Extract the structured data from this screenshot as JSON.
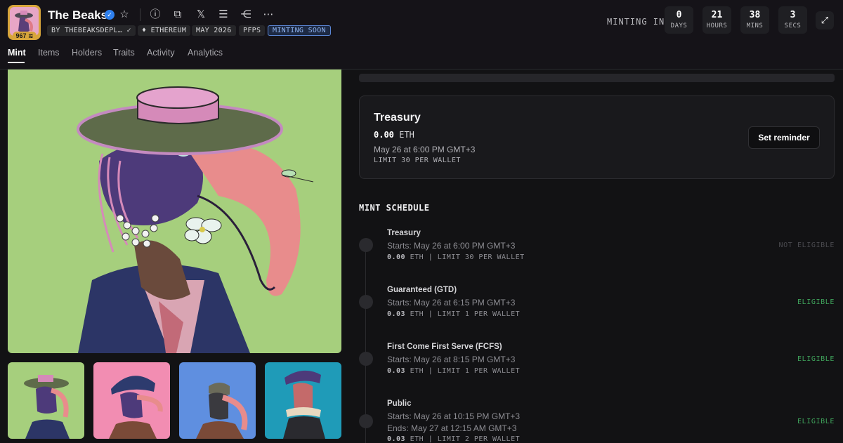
{
  "header": {
    "collection_name": "The Beaks",
    "logo_badge": "967",
    "tags": [
      "BY THEBEAKSDEPL…",
      "ETHEREUM",
      "MAY 2026",
      "PFPS",
      "MINTING SOON"
    ],
    "minting_in_label": "MINTING IN",
    "countdown": [
      {
        "value": "0",
        "label": "DAYS"
      },
      {
        "value": "21",
        "label": "HOURS"
      },
      {
        "value": "38",
        "label": "MINS"
      },
      {
        "value": "3",
        "label": "SECS"
      }
    ],
    "icons": [
      "star-icon",
      "info-icon",
      "copy-icon",
      "x-icon",
      "stack-icon",
      "share-icon",
      "more-icon"
    ]
  },
  "tabs": [
    "Mint",
    "Items",
    "Holders",
    "Traits",
    "Activity",
    "Analytics"
  ],
  "active_tab": "Mint",
  "current_stage": {
    "title": "Treasury",
    "price": "0.00",
    "currency": "ETH",
    "date": "May 26 at 6:00 PM GMT+3",
    "limit": "LIMIT 30 PER WALLET",
    "reminder_label": "Set reminder"
  },
  "schedule": {
    "title": "MINT SCHEDULE",
    "phases": [
      {
        "name": "Treasury",
        "starts": "Starts: May 26 at 6:00 PM GMT+3",
        "ends": "",
        "price": "0.00",
        "meta": "ETH | LIMIT 30 PER WALLET",
        "status": "NOT ELIGIBLE"
      },
      {
        "name": "Guaranteed (GTD)",
        "starts": "Starts: May 26 at 6:15 PM GMT+3",
        "ends": "",
        "price": "0.03",
        "meta": "ETH | LIMIT 1 PER WALLET",
        "status": "ELIGIBLE"
      },
      {
        "name": "First Come First Serve (FCFS)",
        "starts": "Starts: May 26 at 8:15 PM GMT+3",
        "ends": "",
        "price": "0.03",
        "meta": "ETH | LIMIT 1 PER WALLET",
        "status": "ELIGIBLE"
      },
      {
        "name": "Public",
        "starts": "Starts: May 26 at 10:15 PM GMT+3",
        "ends": "Ends: May 27 at 12:15 AM GMT+3",
        "price": "0.03",
        "meta": "ETH | LIMIT 2 PER WALLET",
        "status": "ELIGIBLE"
      }
    ]
  },
  "colors": {
    "background": "#121214",
    "hero_bg": "#a6cf7d",
    "eligible": "#3fa25b",
    "accent_tag": "#5b87d6",
    "thumb_bgs": [
      "#a6cf7d",
      "#f28db2",
      "#5f8fe0",
      "#1f9bb8"
    ]
  }
}
